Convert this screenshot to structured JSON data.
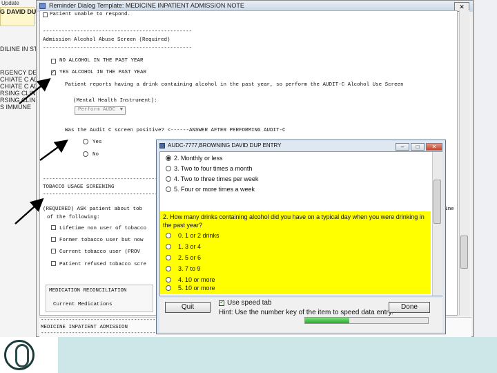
{
  "background_app": {
    "tab_label": "Update",
    "left_lines": [
      "G DAVID DU",
      "DILINE IN STI",
      "RGENCY DEPA",
      "CHIATE C ADD",
      "CHIATE C ADD",
      "RSING CLINICS",
      "RSING CLINICS",
      "S IMMUNE"
    ]
  },
  "main_window": {
    "title": "Reminder Dialog Template: MEDICINE INPATIENT ADMISSION NOTE",
    "close_label": "✕",
    "lines": {
      "patient_unable": "Patient unable to respond.",
      "separator": "------------------------------------------------",
      "alcohol_heading": "Admission Alcohol Abuse Screen  (Required)",
      "no_alcohol": "NO ALCOHOL IN THE PAST YEAR",
      "yes_alcohol": "YES ALCOHOL IN THE PAST YEAR",
      "audit_instruction": "Patient reports having a drink containing alcohol in the past year, so perform the AUDIT-C Alcohol Use Screen",
      "mental_health": "(Mental Health Instrument):",
      "dropdown_value": "Perform AUDC",
      "audit_positive_q": "Was the Audit C screen positive?   <------ANSWER AFTER PERFORMING AUDIT-C",
      "yes_label": "Yes",
      "no_label": "No",
      "tobacco_heading": "TOBACCO USAGE SCREENING",
      "required_ask": "(REQUIRED)  ASK patient about tob",
      "of_following": "of the following:",
      "lifetime_non_user": "Lifetime non user of tobacco",
      "former_user": "Former tobacco user but now",
      "current_user": "Current tobacco user    (PROV",
      "refused": "Patient refused tobacco scre",
      "med_recon": "MEDICATION RECONCILIATION",
      "current_meds": "Current Medications",
      "right_fragment": "ime",
      "footer_title": "MEDICINE INPATIENT ADMISSION",
      "footer_separator": "------------------------------------------------"
    }
  },
  "audc_dialog": {
    "title": "AUDC-7777,BROWNING DAVID DUP ENTRY",
    "min_label": "–",
    "max_label": "□",
    "close_label": "✕",
    "options_top": [
      "2. Monthly or less",
      "3. Two to four times a month",
      "4. Two to three times per week",
      "5. Four or more times a week"
    ],
    "question": "2. How many drinks containing alcohol did you have on a typical day when you were drinking in the past year?",
    "options_q2": [
      "1 or 2 drinks",
      "3 or 4",
      "5 or 6",
      "7 to 9",
      "10 or more",
      "5. 10 or more"
    ],
    "options_q2_display": [
      "0. 1 or 2 drinks",
      "1. 3 or 4",
      "2. 5 or 6",
      "3. 7 to 9",
      "4. 10 or more",
      "5. 10 or more"
    ],
    "quit_label": "Quit",
    "done_label": "Done",
    "speed_tab_label": "Use speed tab",
    "hint": "Hint: Use the number key of the item to speed data entry.",
    "progress_fraction": 0.36
  },
  "colors": {
    "question_highlight": "#ffff00",
    "arrow": "#000000",
    "progress": "#2aa72a"
  }
}
